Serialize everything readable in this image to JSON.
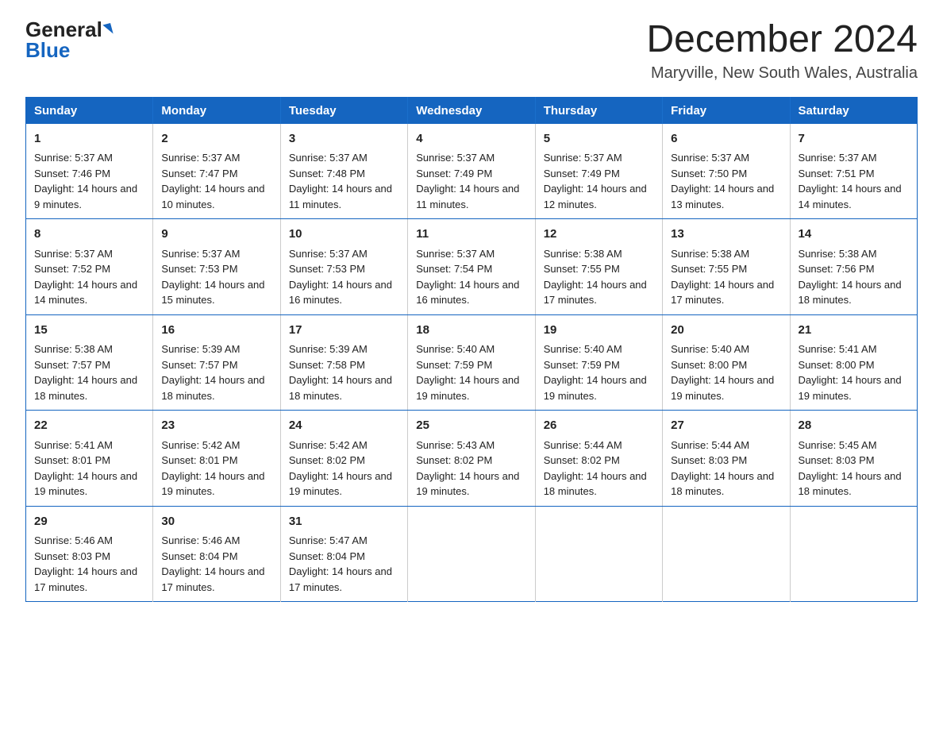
{
  "logo": {
    "general": "General",
    "blue": "Blue"
  },
  "header": {
    "title": "December 2024",
    "subtitle": "Maryville, New South Wales, Australia"
  },
  "weekdays": [
    "Sunday",
    "Monday",
    "Tuesday",
    "Wednesday",
    "Thursday",
    "Friday",
    "Saturday"
  ],
  "weeks": [
    [
      {
        "day": "1",
        "sunrise": "5:37 AM",
        "sunset": "7:46 PM",
        "daylight": "14 hours and 9 minutes."
      },
      {
        "day": "2",
        "sunrise": "5:37 AM",
        "sunset": "7:47 PM",
        "daylight": "14 hours and 10 minutes."
      },
      {
        "day": "3",
        "sunrise": "5:37 AM",
        "sunset": "7:48 PM",
        "daylight": "14 hours and 11 minutes."
      },
      {
        "day": "4",
        "sunrise": "5:37 AM",
        "sunset": "7:49 PM",
        "daylight": "14 hours and 11 minutes."
      },
      {
        "day": "5",
        "sunrise": "5:37 AM",
        "sunset": "7:49 PM",
        "daylight": "14 hours and 12 minutes."
      },
      {
        "day": "6",
        "sunrise": "5:37 AM",
        "sunset": "7:50 PM",
        "daylight": "14 hours and 13 minutes."
      },
      {
        "day": "7",
        "sunrise": "5:37 AM",
        "sunset": "7:51 PM",
        "daylight": "14 hours and 14 minutes."
      }
    ],
    [
      {
        "day": "8",
        "sunrise": "5:37 AM",
        "sunset": "7:52 PM",
        "daylight": "14 hours and 14 minutes."
      },
      {
        "day": "9",
        "sunrise": "5:37 AM",
        "sunset": "7:53 PM",
        "daylight": "14 hours and 15 minutes."
      },
      {
        "day": "10",
        "sunrise": "5:37 AM",
        "sunset": "7:53 PM",
        "daylight": "14 hours and 16 minutes."
      },
      {
        "day": "11",
        "sunrise": "5:37 AM",
        "sunset": "7:54 PM",
        "daylight": "14 hours and 16 minutes."
      },
      {
        "day": "12",
        "sunrise": "5:38 AM",
        "sunset": "7:55 PM",
        "daylight": "14 hours and 17 minutes."
      },
      {
        "day": "13",
        "sunrise": "5:38 AM",
        "sunset": "7:55 PM",
        "daylight": "14 hours and 17 minutes."
      },
      {
        "day": "14",
        "sunrise": "5:38 AM",
        "sunset": "7:56 PM",
        "daylight": "14 hours and 18 minutes."
      }
    ],
    [
      {
        "day": "15",
        "sunrise": "5:38 AM",
        "sunset": "7:57 PM",
        "daylight": "14 hours and 18 minutes."
      },
      {
        "day": "16",
        "sunrise": "5:39 AM",
        "sunset": "7:57 PM",
        "daylight": "14 hours and 18 minutes."
      },
      {
        "day": "17",
        "sunrise": "5:39 AM",
        "sunset": "7:58 PM",
        "daylight": "14 hours and 18 minutes."
      },
      {
        "day": "18",
        "sunrise": "5:40 AM",
        "sunset": "7:59 PM",
        "daylight": "14 hours and 19 minutes."
      },
      {
        "day": "19",
        "sunrise": "5:40 AM",
        "sunset": "7:59 PM",
        "daylight": "14 hours and 19 minutes."
      },
      {
        "day": "20",
        "sunrise": "5:40 AM",
        "sunset": "8:00 PM",
        "daylight": "14 hours and 19 minutes."
      },
      {
        "day": "21",
        "sunrise": "5:41 AM",
        "sunset": "8:00 PM",
        "daylight": "14 hours and 19 minutes."
      }
    ],
    [
      {
        "day": "22",
        "sunrise": "5:41 AM",
        "sunset": "8:01 PM",
        "daylight": "14 hours and 19 minutes."
      },
      {
        "day": "23",
        "sunrise": "5:42 AM",
        "sunset": "8:01 PM",
        "daylight": "14 hours and 19 minutes."
      },
      {
        "day": "24",
        "sunrise": "5:42 AM",
        "sunset": "8:02 PM",
        "daylight": "14 hours and 19 minutes."
      },
      {
        "day": "25",
        "sunrise": "5:43 AM",
        "sunset": "8:02 PM",
        "daylight": "14 hours and 19 minutes."
      },
      {
        "day": "26",
        "sunrise": "5:44 AM",
        "sunset": "8:02 PM",
        "daylight": "14 hours and 18 minutes."
      },
      {
        "day": "27",
        "sunrise": "5:44 AM",
        "sunset": "8:03 PM",
        "daylight": "14 hours and 18 minutes."
      },
      {
        "day": "28",
        "sunrise": "5:45 AM",
        "sunset": "8:03 PM",
        "daylight": "14 hours and 18 minutes."
      }
    ],
    [
      {
        "day": "29",
        "sunrise": "5:46 AM",
        "sunset": "8:03 PM",
        "daylight": "14 hours and 17 minutes."
      },
      {
        "day": "30",
        "sunrise": "5:46 AM",
        "sunset": "8:04 PM",
        "daylight": "14 hours and 17 minutes."
      },
      {
        "day": "31",
        "sunrise": "5:47 AM",
        "sunset": "8:04 PM",
        "daylight": "14 hours and 17 minutes."
      },
      null,
      null,
      null,
      null
    ]
  ],
  "labels": {
    "sunrise": "Sunrise:",
    "sunset": "Sunset:",
    "daylight": "Daylight:"
  }
}
